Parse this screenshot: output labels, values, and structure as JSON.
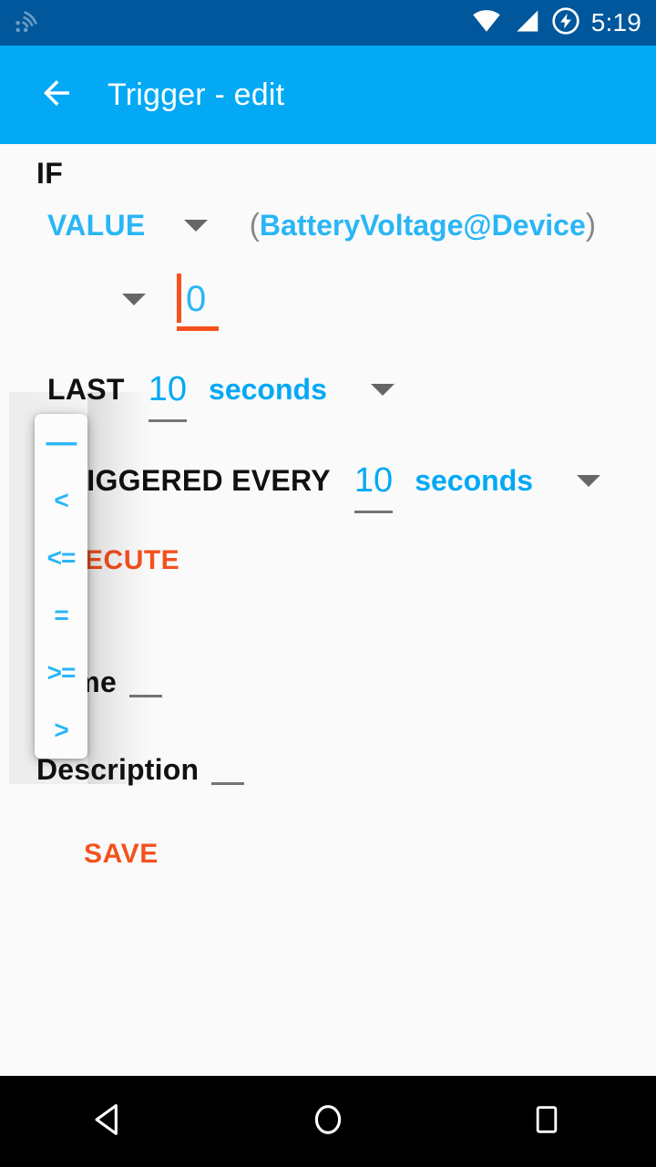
{
  "status_bar": {
    "time": "5:19",
    "icons": [
      "cast-screen-icon",
      "wifi-icon",
      "cellular-signal-icon",
      "battery-charging-icon"
    ],
    "background_color": "#01579B"
  },
  "app_bar": {
    "back_icon": "arrow-left-icon",
    "title": "Trigger - edit",
    "background_color": "#03A9F4"
  },
  "trigger_form": {
    "if_label": "IF",
    "source": {
      "type_label": "VALUE",
      "type_caret": "chevron-down-icon",
      "open_paren": "(",
      "expression": "BatteryVoltage@Device",
      "close_paren": ")"
    },
    "condition": {
      "operator_caret": "chevron-down-icon",
      "threshold_value": "0"
    },
    "duration": {
      "prefix_label": "LAST",
      "amount": "10",
      "unit": "seconds",
      "unit_caret": "chevron-down-icon"
    },
    "repeat": {
      "prefix_label": "TRIGGERED EVERY",
      "amount": "10",
      "unit": "seconds",
      "unit_caret": "chevron-down-icon"
    },
    "execute_label": "EXECUTE",
    "name_label": "Name",
    "name_value": "",
    "description_label": "Description",
    "description_value": "",
    "save_label": "SAVE"
  },
  "operator_dropdown": {
    "open": true,
    "selected_index": 0,
    "options": [
      "—",
      "<",
      "<=",
      "=",
      ">=",
      ">"
    ]
  },
  "navigation_bar": {
    "back": "nav-back-icon",
    "home": "nav-home-icon",
    "recents": "nav-recents-icon"
  },
  "colors": {
    "status_bar": "#01579B",
    "app_bar": "#03A9F4",
    "accent_blue": "#29B6F6",
    "accent_orange": "#F4511E",
    "background": "#FAFAFA"
  }
}
